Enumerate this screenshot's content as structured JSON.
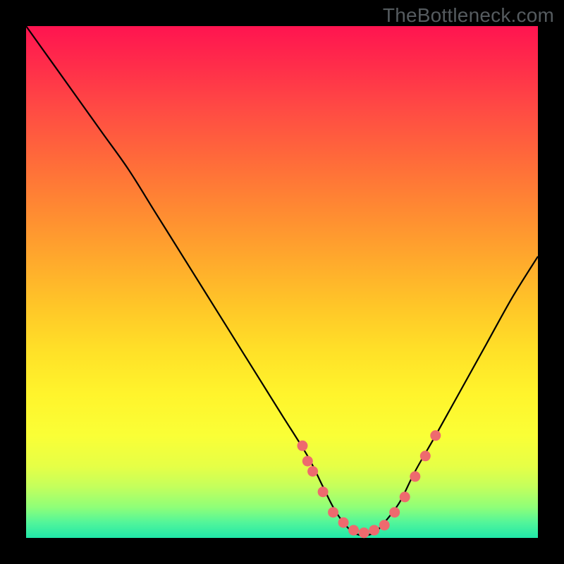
{
  "watermark": "TheBottleneck.com",
  "chart_data": {
    "type": "line",
    "title": "",
    "xlabel": "",
    "ylabel": "",
    "xlim": [
      0,
      100
    ],
    "ylim": [
      0,
      100
    ],
    "series": [
      {
        "name": "curve",
        "x": [
          0,
          5,
          10,
          15,
          20,
          25,
          30,
          35,
          40,
          45,
          50,
          55,
          58,
          60,
          62,
          64,
          66,
          68,
          70,
          73,
          76,
          80,
          85,
          90,
          95,
          100
        ],
        "values": [
          100,
          93,
          86,
          79,
          72,
          64,
          56,
          48,
          40,
          32,
          24,
          16,
          10,
          6,
          3,
          1,
          0.5,
          1,
          3,
          7,
          13,
          20,
          29,
          38,
          47,
          55
        ]
      }
    ],
    "markers": {
      "name": "dots",
      "color": "#ee6a6e",
      "x": [
        54,
        55,
        56,
        58,
        60,
        62,
        64,
        66,
        68,
        70,
        72,
        74,
        76,
        78,
        80
      ],
      "values": [
        18,
        15,
        13,
        9,
        5,
        3,
        1.5,
        1,
        1.5,
        2.5,
        5,
        8,
        12,
        16,
        20
      ]
    },
    "gradient_bg": {
      "top_color": "#ff1450",
      "mid_colors": [
        "#ff8a32",
        "#fff42c"
      ],
      "bottom_color": "#20e7a8"
    }
  }
}
